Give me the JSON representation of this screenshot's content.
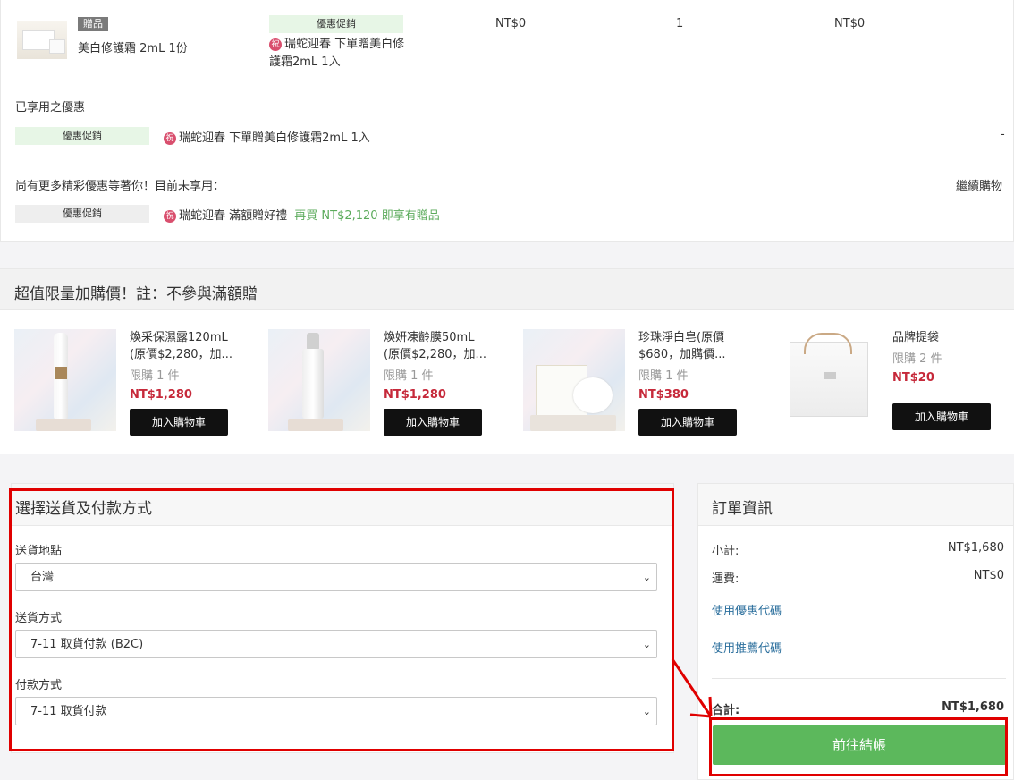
{
  "cart_item": {
    "badge": "贈品",
    "name": "美白修護霜 2mL 1份",
    "promo_tag": "優惠促銷",
    "promo_text": "瑞蛇迎春 下單贈美白修護霜2mL 1入",
    "promo_icon": "祝",
    "price": "NT$0",
    "qty": "1",
    "subtotal": "NT$0"
  },
  "applied": {
    "title": "已享用之優惠",
    "tag": "優惠促銷",
    "icon": "祝",
    "text": "瑞蛇迎春 下單贈美白修護霜2mL 1入",
    "amount": "-"
  },
  "more_offers": {
    "title": "尚有更多精彩優惠等著你！目前未享用：",
    "continue_link": "繼續購物",
    "tag": "優惠促銷",
    "icon": "祝",
    "text": "瑞蛇迎春 滿額贈好禮",
    "highlight": "再買 NT$2,120 即享有贈品"
  },
  "addon": {
    "title": "超值限量加購價！註：不參與滿額贈",
    "products": [
      {
        "name1": "煥采保濕露120mL",
        "name2": "(原價$2,280，加...",
        "limit": "限購 1 件",
        "price": "NT$1,280",
        "button": "加入購物車"
      },
      {
        "name1": "煥妍凍齡膜50mL",
        "name2": "(原價$2,280，加...",
        "limit": "限購 1 件",
        "price": "NT$1,280",
        "button": "加入購物車"
      },
      {
        "name1": "珍珠淨白皂(原價",
        "name2": "$680，加購價...",
        "limit": "限購 1 件",
        "price": "NT$380",
        "button": "加入購物車"
      },
      {
        "name1": "品牌提袋",
        "name2": "",
        "limit": "限購 2 件",
        "price": "NT$20",
        "button": "加入購物車"
      }
    ]
  },
  "shipping": {
    "title": "選擇送貨及付款方式",
    "location_label": "送貨地點",
    "location_value": "台灣",
    "method_label": "送貨方式",
    "method_value": "7-11 取貨付款 (B2C)",
    "payment_label": "付款方式",
    "payment_value": "7-11 取貨付款"
  },
  "order": {
    "title": "訂單資訊",
    "subtotal_label": "小計:",
    "subtotal_value": "NT$1,680",
    "shipping_label": "運費:",
    "shipping_value": "NT$0",
    "coupon_link": "使用優惠代碼",
    "referral_link": "使用推薦代碼",
    "total_label": "合計:",
    "total_value": "NT$1,680",
    "checkout": "前往結帳"
  },
  "colors": {
    "checkout_green": "#5cb85c",
    "highlight_red": "#e00000",
    "price_red": "#c6293a",
    "promo_green": "#5cab5c"
  }
}
